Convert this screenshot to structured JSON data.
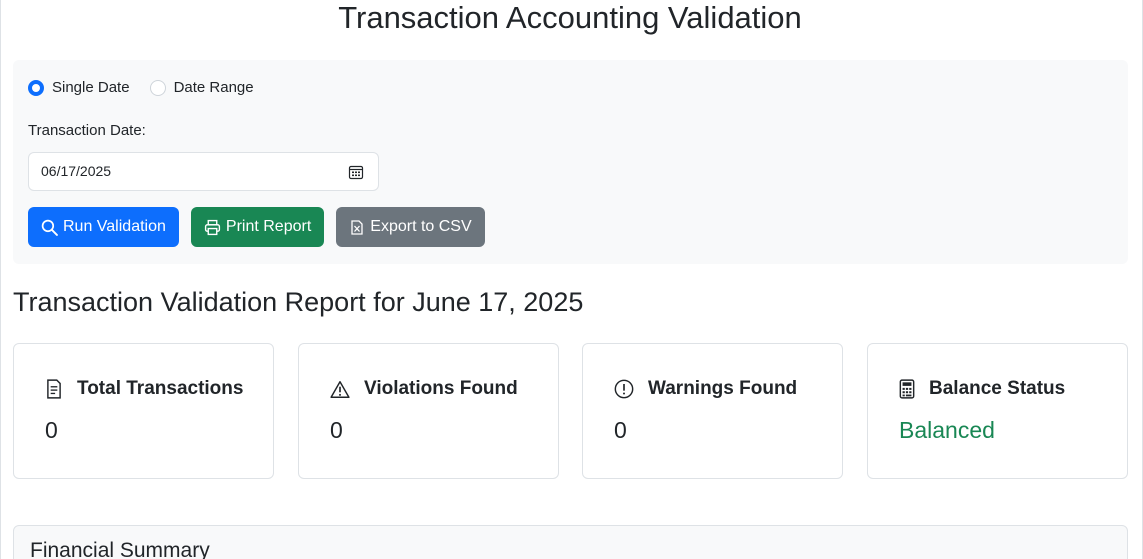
{
  "header": {
    "title": "Transaction Accounting Validation"
  },
  "filters": {
    "mode_options": [
      {
        "label": "Single Date",
        "selected": true
      },
      {
        "label": "Date Range",
        "selected": false
      }
    ],
    "date_label": "Transaction Date:",
    "date_value": "06/17/2025"
  },
  "actions": {
    "run_label": "Run Validation",
    "print_label": "Print Report",
    "export_label": "Export to CSV"
  },
  "report": {
    "title": "Transaction Validation Report for June 17, 2025",
    "cards": [
      {
        "title": "Total Transactions",
        "value": "0",
        "icon": "document-icon"
      },
      {
        "title": "Violations Found",
        "value": "0",
        "icon": "warning-icon"
      },
      {
        "title": "Warnings Found",
        "value": "0",
        "icon": "exclamation-circle-icon"
      },
      {
        "title": "Balance Status",
        "value": "Balanced",
        "icon": "calculator-icon"
      }
    ],
    "summary_title": "Financial Summary"
  },
  "colors": {
    "primary": "#0d6efd",
    "success": "#198754",
    "secondary": "#6c757d"
  }
}
